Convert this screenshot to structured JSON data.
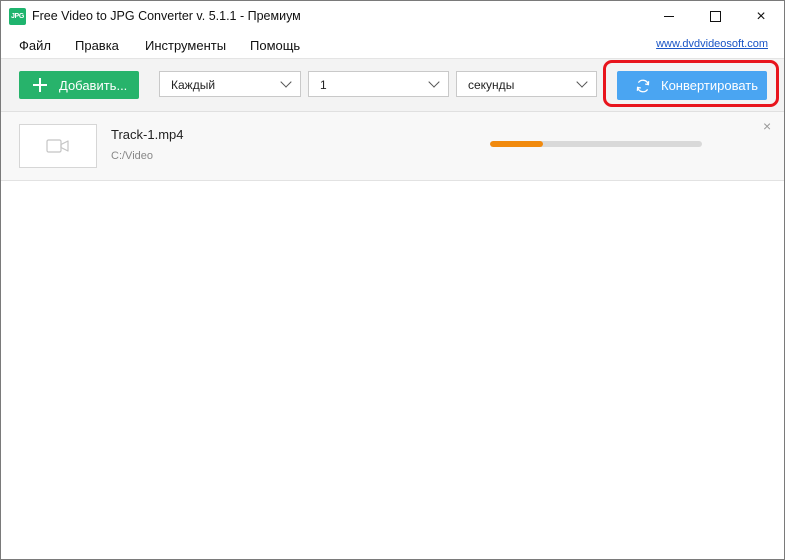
{
  "window": {
    "title": "Free Video to JPG Converter v. 5.1.1 - Премиум",
    "icon_text": "JPG",
    "controls": {
      "minimize": "minimize-icon",
      "maximize": "maximize-icon",
      "close": "×"
    }
  },
  "menu": {
    "items": [
      "Файл",
      "Правка",
      "Инструменты",
      "Помощь"
    ],
    "link": "www.dvdvideosoft.com"
  },
  "toolbar": {
    "add_label": "Добавить...",
    "every_select": "Каждый",
    "number_select": "1",
    "unit_select": "секунды",
    "convert_label": "Конвертировать"
  },
  "file": {
    "name": "Track-1.mp4",
    "path": "C:/Video",
    "progress_percent": 25,
    "remove": "×"
  },
  "colors": {
    "add_button": "#27b36b",
    "convert_button": "#4aa5f2",
    "progress_fill": "#f18a0e",
    "highlight": "#e8141c"
  }
}
